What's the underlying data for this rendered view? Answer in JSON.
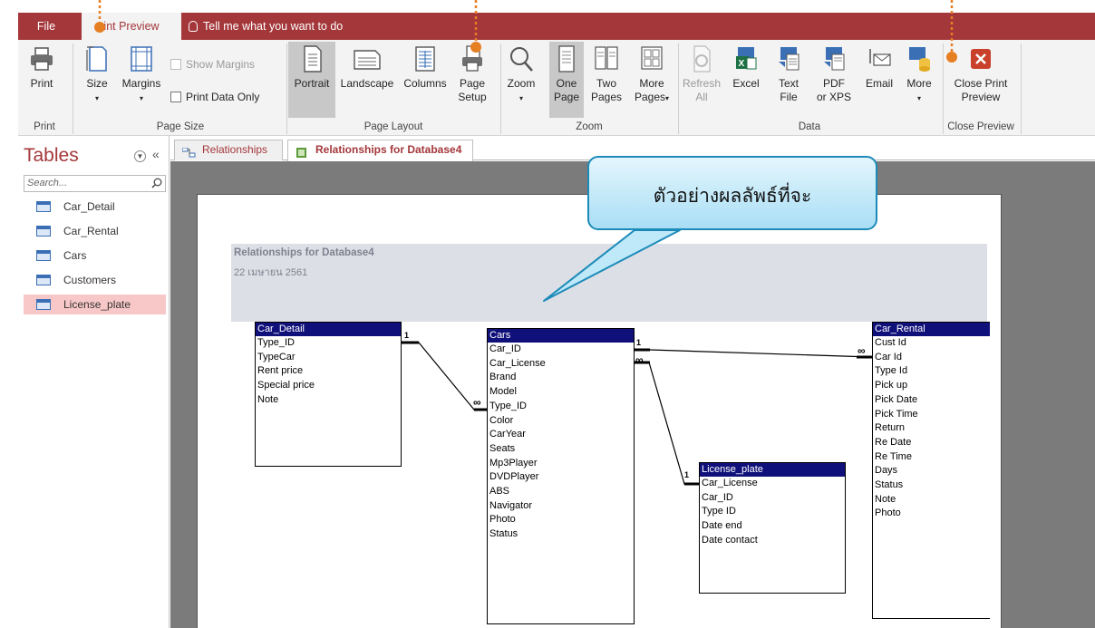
{
  "ribbon_tabs": {
    "file": "File",
    "print_preview": "int Preview",
    "tell_me": "Tell me what you want to do"
  },
  "ribbon": {
    "print": "Print",
    "size": "Size",
    "margins": "Margins",
    "show_margins": "Show Margins",
    "print_data_only": "Print Data Only",
    "portrait": "Portrait",
    "landscape": "Landscape",
    "columns": "Columns",
    "page_setup_1": "Page",
    "page_setup_2": "Setup",
    "zoom": "Zoom",
    "one_page_1": "One",
    "one_page_2": "Page",
    "two_pages_1": "Two",
    "two_pages_2": "Pages",
    "more_pages_1": "More",
    "more_pages_2": "Pages",
    "refresh_all_1": "Refresh",
    "refresh_all_2": "All",
    "excel": "Excel",
    "text_file_1": "Text",
    "text_file_2": "File",
    "pdf_1": "PDF",
    "pdf_2": "or XPS",
    "email": "Email",
    "more": "More",
    "close_print_1": "Close Print",
    "close_print_2": "Preview",
    "groups": {
      "print": "Print",
      "page_size": "Page Size",
      "page_layout": "Page Layout",
      "zoom": "Zoom",
      "data": "Data",
      "close_preview": "Close Preview"
    }
  },
  "nav": {
    "title": "Tables",
    "search_placeholder": "Search...",
    "items": [
      "Car_Detail",
      "Car_Rental",
      "Cars",
      "Customers",
      "License_plate"
    ],
    "selected": "License_plate"
  },
  "doc_tabs": [
    "Relationships",
    "Relationships for Database4"
  ],
  "report": {
    "title": "Relationships for Database4",
    "date": "22 เมษายน 2561"
  },
  "entities": {
    "car_detail": {
      "name": "Car_Detail",
      "fields": [
        "Type_ID",
        "TypeCar",
        "Rent price",
        "Special price",
        "Note"
      ]
    },
    "cars": {
      "name": "Cars",
      "fields": [
        "Car_ID",
        "Car_License",
        "Brand",
        "Model",
        "Type_ID",
        "Color",
        "CarYear",
        "Seats",
        "Mp3Player",
        "DVDPlayer",
        "ABS",
        "Navigator",
        "Photo",
        "Status"
      ]
    },
    "license_plate": {
      "name": "License_plate",
      "fields": [
        "Car_License",
        "Car_ID",
        "Type ID",
        "Date end",
        "Date contact"
      ]
    },
    "car_rental": {
      "name": "Car_Rental",
      "fields": [
        "Cust Id",
        "Car Id",
        "Type Id",
        "Pick up",
        "Pick Date",
        "Pick Time",
        "Return",
        "Re Date",
        "Re Time",
        "Days",
        "Status",
        "Note",
        "Photo"
      ]
    }
  },
  "relations": {
    "one": "1",
    "many": "∞"
  },
  "callout": "ตัวอย่างผลลัพธ์ที่จะ",
  "colors": {
    "accent": "#a4373a",
    "header_navy": "#10107a",
    "callout_border": "#1c8bb9",
    "annotation": "#e67e22"
  }
}
